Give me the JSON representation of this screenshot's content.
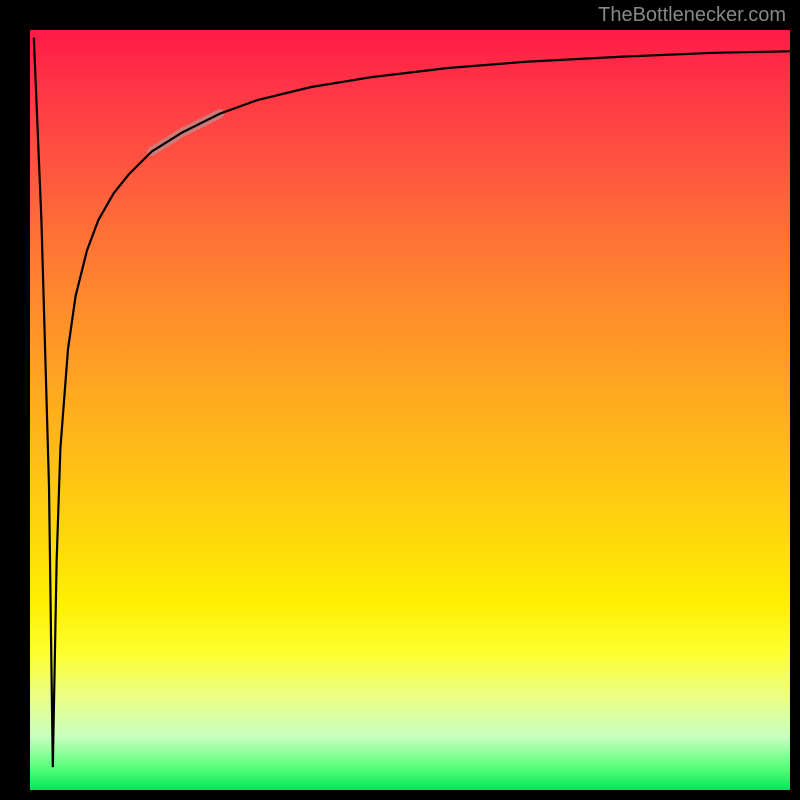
{
  "watermark": "TheBottlenecker.com",
  "chart_data": {
    "type": "line",
    "title": "",
    "xlabel": "",
    "ylabel": "",
    "xlim": [
      0,
      100
    ],
    "ylim": [
      0,
      100
    ],
    "background_gradient": {
      "description": "vertical gradient red (top) → yellow → green (bottom)",
      "stops": [
        {
          "pos": 0.0,
          "color": "#ff1a47"
        },
        {
          "pos": 0.3,
          "color": "#ff7a33"
        },
        {
          "pos": 0.66,
          "color": "#ffd60d"
        },
        {
          "pos": 0.88,
          "color": "#eaff8a"
        },
        {
          "pos": 1.0,
          "color": "#00e85c"
        }
      ]
    },
    "series": [
      {
        "name": "bottleneck-curve",
        "description": "Sharp V-dip near x≈3 down to y≈3, then logarithmic-like rise asymptoting near y≈97",
        "x": [
          0.5,
          1.5,
          2.5,
          3.0,
          3.5,
          4.0,
          5.0,
          6.0,
          7.5,
          9.0,
          11.0,
          13.0,
          16.0,
          20.0,
          25.0,
          30.0,
          37.0,
          45.0,
          55.0,
          65.0,
          78.0,
          90.0,
          100.0
        ],
        "y": [
          99.0,
          75.0,
          40.0,
          3.0,
          30.0,
          45.0,
          58.0,
          65.0,
          71.0,
          75.0,
          78.5,
          81.0,
          84.0,
          86.5,
          89.0,
          90.8,
          92.5,
          93.8,
          95.0,
          95.8,
          96.5,
          97.0,
          97.2
        ]
      }
    ],
    "highlight_segment": {
      "description": "thicker muted-red overlay on rising part of curve",
      "x_range": [
        16.0,
        25.0
      ],
      "y_range": [
        84.0,
        89.0
      ]
    }
  }
}
